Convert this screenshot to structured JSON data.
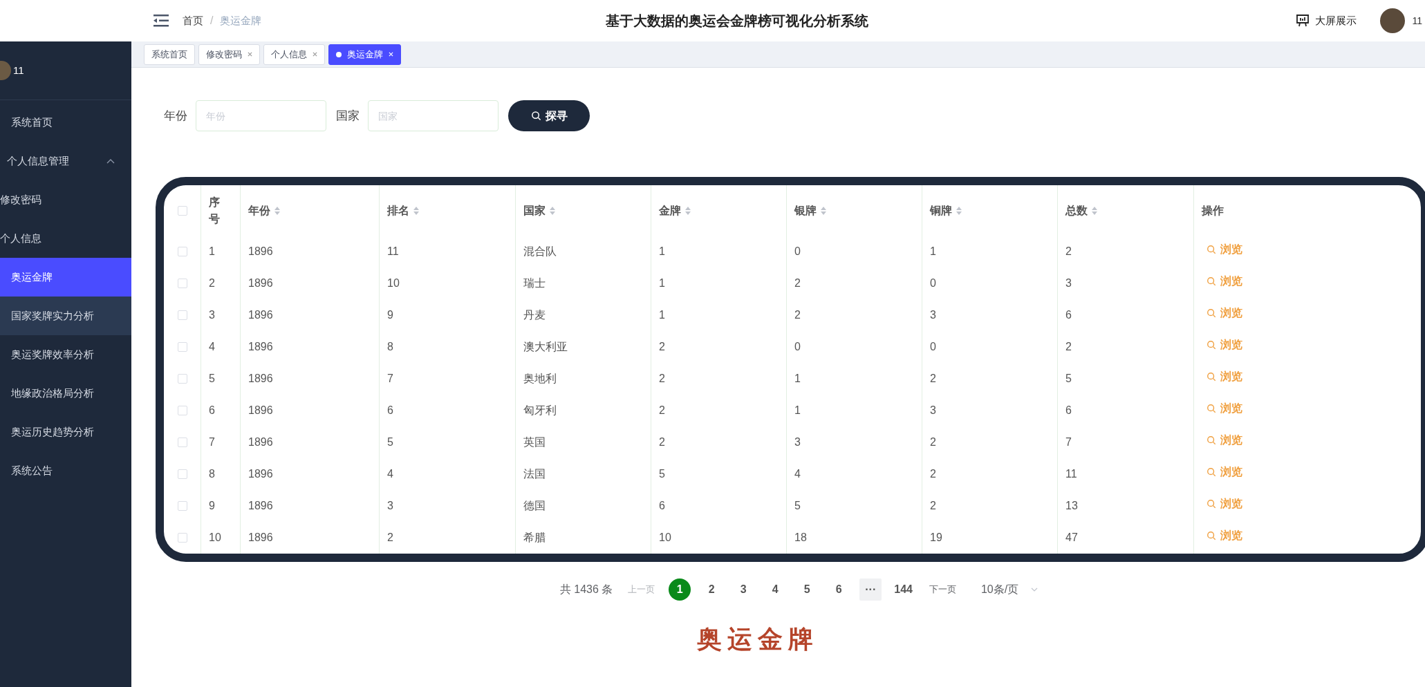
{
  "header": {
    "breadcrumb": [
      "首页",
      "奥运金牌"
    ],
    "breadcrumb_separator": "/",
    "title": "基于大数据的奥运会金牌榜可视化分析系统",
    "screen_button": "大屏展示",
    "user": "11"
  },
  "tabs": [
    {
      "label": "系统首页",
      "selected": false,
      "closable": false
    },
    {
      "label": "修改密码",
      "selected": false,
      "closable": true
    },
    {
      "label": "个人信息",
      "selected": false,
      "closable": true
    },
    {
      "label": "奥运金牌",
      "selected": true,
      "closable": true
    }
  ],
  "sidebar": {
    "user": "11",
    "items": [
      {
        "label": "系统首页",
        "selected": false,
        "hovered": false,
        "kind": "item"
      },
      {
        "label": "个人信息管理",
        "selected": false,
        "hovered": false,
        "kind": "group",
        "expanded": true,
        "children": [
          {
            "label": "修改密码",
            "selected": false,
            "hovered": false,
            "kind": "sub"
          },
          {
            "label": "个人信息",
            "selected": false,
            "hovered": false,
            "kind": "sub"
          }
        ]
      },
      {
        "label": "奥运金牌",
        "selected": true,
        "hovered": false,
        "kind": "item"
      },
      {
        "label": "国家奖牌实力分析",
        "selected": false,
        "hovered": true,
        "kind": "item"
      },
      {
        "label": "奥运奖牌效率分析",
        "selected": false,
        "hovered": false,
        "kind": "item"
      },
      {
        "label": "地缘政治格局分析",
        "selected": false,
        "hovered": false,
        "kind": "item"
      },
      {
        "label": "奥运历史趋势分析",
        "selected": false,
        "hovered": false,
        "kind": "item"
      },
      {
        "label": "系统公告",
        "selected": false,
        "hovered": false,
        "kind": "item"
      }
    ]
  },
  "search": {
    "fields": [
      {
        "label": "年份",
        "placeholder": "年份"
      },
      {
        "label": "国家",
        "placeholder": "国家"
      }
    ],
    "button": "探寻"
  },
  "table": {
    "all_checked": false,
    "columns": [
      {
        "label": "序号",
        "sortable": false
      },
      {
        "label": "年份",
        "sortable": true
      },
      {
        "label": "排名",
        "sortable": true
      },
      {
        "label": "国家",
        "sortable": true
      },
      {
        "label": "金牌",
        "sortable": true
      },
      {
        "label": "银牌",
        "sortable": true
      },
      {
        "label": "铜牌",
        "sortable": true
      },
      {
        "label": "总数",
        "sortable": true
      },
      {
        "label": "操作",
        "sortable": false
      }
    ],
    "rows": [
      {
        "checked": false,
        "cells": [
          "1",
          "1896",
          "11",
          "混合队",
          "1",
          "0",
          "1",
          "2"
        ],
        "action": "浏览"
      },
      {
        "checked": false,
        "cells": [
          "2",
          "1896",
          "10",
          "瑞士",
          "1",
          "2",
          "0",
          "3"
        ],
        "action": "浏览"
      },
      {
        "checked": false,
        "cells": [
          "3",
          "1896",
          "9",
          "丹麦",
          "1",
          "2",
          "3",
          "6"
        ],
        "action": "浏览"
      },
      {
        "checked": false,
        "cells": [
          "4",
          "1896",
          "8",
          "澳大利亚",
          "2",
          "0",
          "0",
          "2"
        ],
        "action": "浏览"
      },
      {
        "checked": false,
        "cells": [
          "5",
          "1896",
          "7",
          "奥地利",
          "2",
          "1",
          "2",
          "5"
        ],
        "action": "浏览"
      },
      {
        "checked": false,
        "cells": [
          "6",
          "1896",
          "6",
          "匈牙利",
          "2",
          "1",
          "3",
          "6"
        ],
        "action": "浏览"
      },
      {
        "checked": false,
        "cells": [
          "7",
          "1896",
          "5",
          "英国",
          "2",
          "3",
          "2",
          "7"
        ],
        "action": "浏览"
      },
      {
        "checked": false,
        "cells": [
          "8",
          "1896",
          "4",
          "法国",
          "5",
          "4",
          "2",
          "11"
        ],
        "action": "浏览"
      },
      {
        "checked": false,
        "cells": [
          "9",
          "1896",
          "3",
          "德国",
          "6",
          "5",
          "2",
          "13"
        ],
        "action": "浏览"
      },
      {
        "checked": false,
        "cells": [
          "10",
          "1896",
          "2",
          "希腊",
          "10",
          "18",
          "19",
          "47"
        ],
        "action": "浏览"
      }
    ]
  },
  "pagination": {
    "total": "共 1436 条",
    "prev": "上一页",
    "pages": [
      {
        "label": "1",
        "selected": true,
        "kind": "page"
      },
      {
        "label": "2",
        "selected": false,
        "kind": "page"
      },
      {
        "label": "3",
        "selected": false,
        "kind": "page"
      },
      {
        "label": "4",
        "selected": false,
        "kind": "page"
      },
      {
        "label": "5",
        "selected": false,
        "kind": "page"
      },
      {
        "label": "6",
        "selected": false,
        "kind": "page"
      },
      {
        "label": "···",
        "selected": false,
        "kind": "more"
      },
      {
        "label": "144",
        "selected": false,
        "kind": "page"
      }
    ],
    "next": "下一页",
    "page_size": "10条/页"
  },
  "footer_title": "奥运金牌"
}
